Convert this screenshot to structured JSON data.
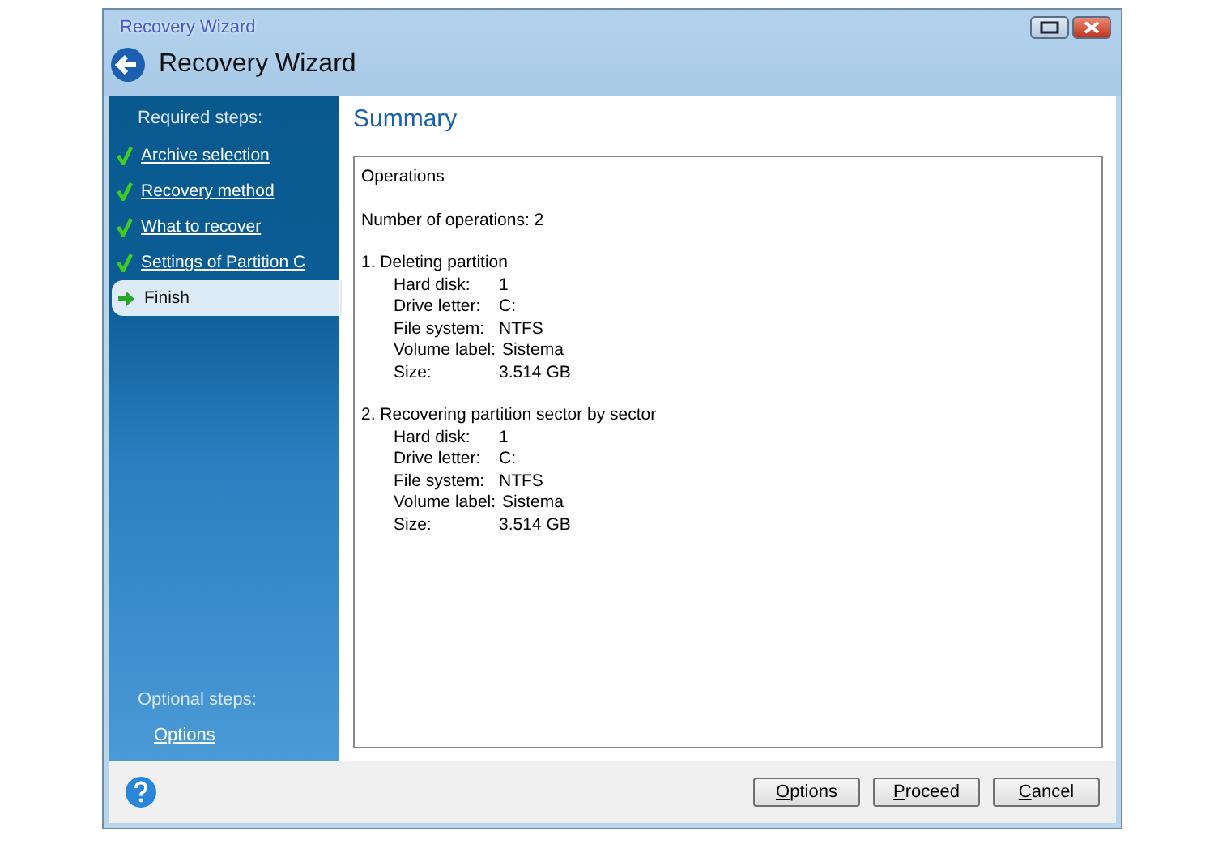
{
  "window": {
    "title": "Recovery Wizard",
    "header": "Recovery Wizard"
  },
  "sidebar": {
    "required_heading": "Required steps:",
    "steps": [
      {
        "label": "Archive selection",
        "completed": true,
        "selected": false
      },
      {
        "label": "Recovery method",
        "completed": true,
        "selected": false
      },
      {
        "label": "What to recover",
        "completed": true,
        "selected": false
      },
      {
        "label": "Settings of Partition C",
        "completed": true,
        "selected": false
      },
      {
        "label": "Finish",
        "completed": false,
        "selected": true
      }
    ],
    "optional_heading": "Optional steps:",
    "optional_links": [
      "Options"
    ]
  },
  "page_title": "Summary",
  "summary": {
    "heading": "Operations",
    "count": "Number of operations: 2",
    "operations": [
      {
        "title": "1. Deleting partition",
        "details": [
          {
            "label": "Hard disk:",
            "value": "1"
          },
          {
            "label": "Drive letter:",
            "value": "C:"
          },
          {
            "label": "File system:",
            "value": "NTFS"
          },
          {
            "label": "Volume label:",
            "value": "Sistema"
          },
          {
            "label": "Size:",
            "value": "3.514 GB"
          }
        ]
      },
      {
        "title": "2. Recovering partition sector by sector",
        "details": [
          {
            "label": "Hard disk:",
            "value": "1"
          },
          {
            "label": "Drive letter:",
            "value": "C:"
          },
          {
            "label": "File system:",
            "value": "NTFS"
          },
          {
            "label": "Volume label:",
            "value": "Sistema"
          },
          {
            "label": "Size:",
            "value": "3.514 GB"
          }
        ]
      }
    ]
  },
  "buttons": [
    "Options",
    "Proceed",
    "Cancel"
  ]
}
